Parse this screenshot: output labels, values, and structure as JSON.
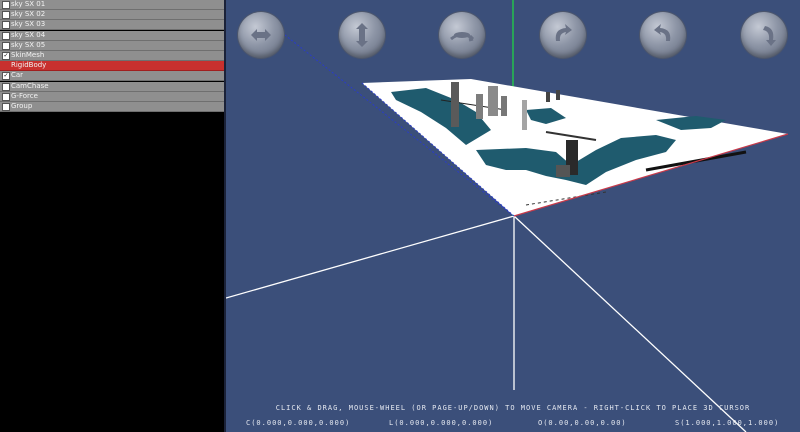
{
  "scene_list": {
    "items": [
      {
        "label": "sky SX 01",
        "checked": false,
        "selected": false,
        "has_checkbox": true
      },
      {
        "label": "sky SX 02",
        "checked": false,
        "selected": false,
        "has_checkbox": true
      },
      {
        "label": "sky SX 03",
        "checked": false,
        "selected": false,
        "has_checkbox": true
      },
      {
        "label": "sky SX 04",
        "checked": false,
        "selected": false,
        "has_checkbox": true
      },
      {
        "label": "sky SX 05",
        "checked": false,
        "selected": false,
        "has_checkbox": true
      },
      {
        "label": "SkinMesh",
        "checked": true,
        "selected": false,
        "has_checkbox": true
      },
      {
        "label": "RigidBody",
        "checked": false,
        "selected": true,
        "has_checkbox": false
      },
      {
        "label": "Car",
        "checked": true,
        "selected": false,
        "has_checkbox": true
      },
      {
        "label": "CamChase",
        "checked": false,
        "selected": false,
        "has_checkbox": true
      },
      {
        "label": "G-Force",
        "checked": false,
        "selected": false,
        "has_checkbox": true
      },
      {
        "label": "Group",
        "checked": false,
        "selected": false,
        "has_checkbox": true
      }
    ]
  },
  "nav_buttons": [
    {
      "name": "pan-horizontal-icon"
    },
    {
      "name": "pan-vertical-icon"
    },
    {
      "name": "orbit-icon"
    },
    {
      "name": "rotate-cw-icon"
    },
    {
      "name": "rotate-ccw-icon"
    },
    {
      "name": "zoom-icon"
    }
  ],
  "viewport": {
    "instructions": "CLICK & DRAG, MOUSE-WHEEL (OR PAGE-UP/DOWN) TO MOVE CAMERA - RIGHT-CLICK TO PLACE 3D CURSOR",
    "camera_readout": "C(0.000,0.000,0.000)",
    "look_readout": "L(0.000,0.000,0.000)",
    "orientation_readout": "O(0.00,0.00,0.00)",
    "scale_readout": "S(1.000,1.000,1.000)"
  },
  "colors": {
    "viewport_bg": "#3b4f7a",
    "selected_row": "#c8302e",
    "row_bg": "#8f8f8f",
    "axis_green": "#22c84a",
    "axis_red": "#c83a4a",
    "axis_blue": "#2a3cc8",
    "water": "#1f5b6e"
  }
}
